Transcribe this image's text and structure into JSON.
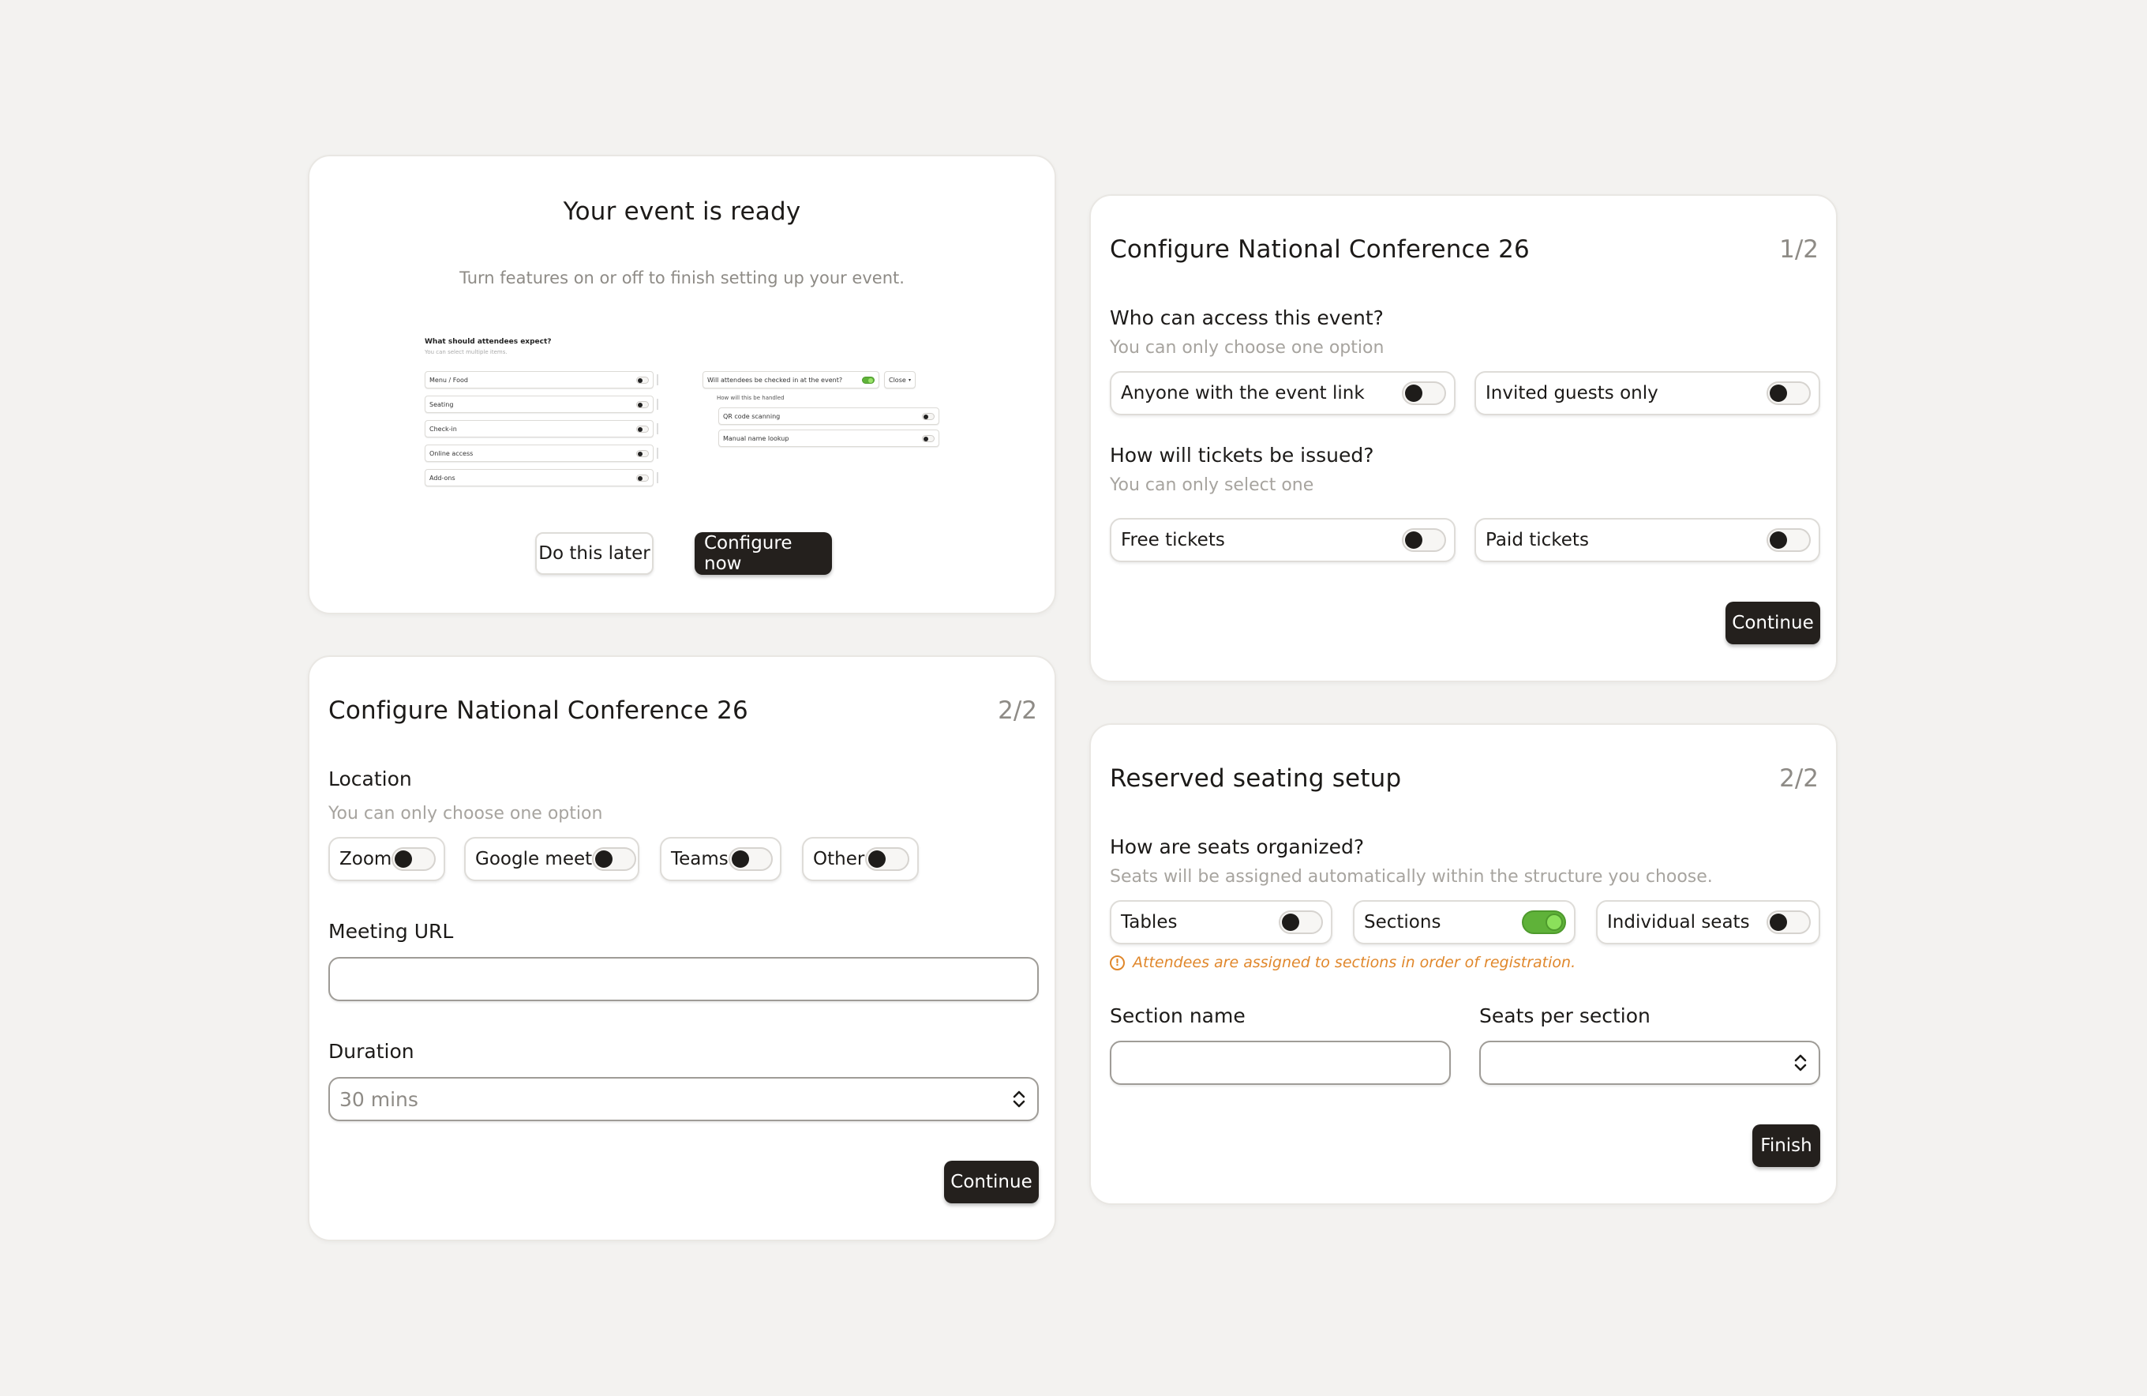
{
  "ready_card": {
    "title": "Your event is ready",
    "subtitle": "Turn features on or off to finish setting up your event.",
    "preview": {
      "left_title": "What should attendees expect?",
      "left_sub": "You can select multiple items.",
      "left_items": [
        "Menu / Food",
        "Seating",
        "Check-in",
        "Online access",
        "Add-ons"
      ],
      "right_question": "Will attendees be checked in at the event?",
      "right_close": "Close",
      "right_sub": "How will this be handled",
      "right_items": [
        "QR code scanning",
        "Manual name lookup"
      ]
    },
    "later_label": "Do this later",
    "configure_label": "Configure now"
  },
  "access_card": {
    "title": "Configure National Conference 26",
    "step": "1/2",
    "q1": "Who can access this event?",
    "q1_hint": "You can only choose one option",
    "q1_options": [
      "Anyone with the event link",
      "Invited guests only"
    ],
    "q2": "How will tickets be issued?",
    "q2_hint": "You can only select one",
    "q2_options": [
      "Free tickets",
      "Paid tickets"
    ],
    "continue_label": "Continue"
  },
  "location_card": {
    "title": "Configure National Conference 26",
    "step": "2/2",
    "location_label": "Location",
    "location_hint": "You can only choose one option",
    "location_options": [
      "Zoom",
      "Google meet",
      "Teams",
      "Other"
    ],
    "url_label": "Meeting URL",
    "url_value": "",
    "duration_label": "Duration",
    "duration_value": "30 mins",
    "continue_label": "Continue"
  },
  "seating_card": {
    "title": "Reserved seating setup",
    "step": "2/2",
    "question": "How are seats organized?",
    "hint": "Seats will be assigned automatically within the structure you choose.",
    "options": [
      "Tables",
      "Sections",
      "Individual seats"
    ],
    "note": "Attendees are assigned to sections in order of registration.",
    "section_name_label": "Section name",
    "section_name_value": "",
    "seats_label": "Seats per section",
    "seats_value": "",
    "finish_label": "Finish"
  },
  "colors": {
    "background": "#f3f2f0",
    "dark_button": "#24201d",
    "toggle_on": "#5fb239",
    "note_orange": "#e0872b"
  }
}
